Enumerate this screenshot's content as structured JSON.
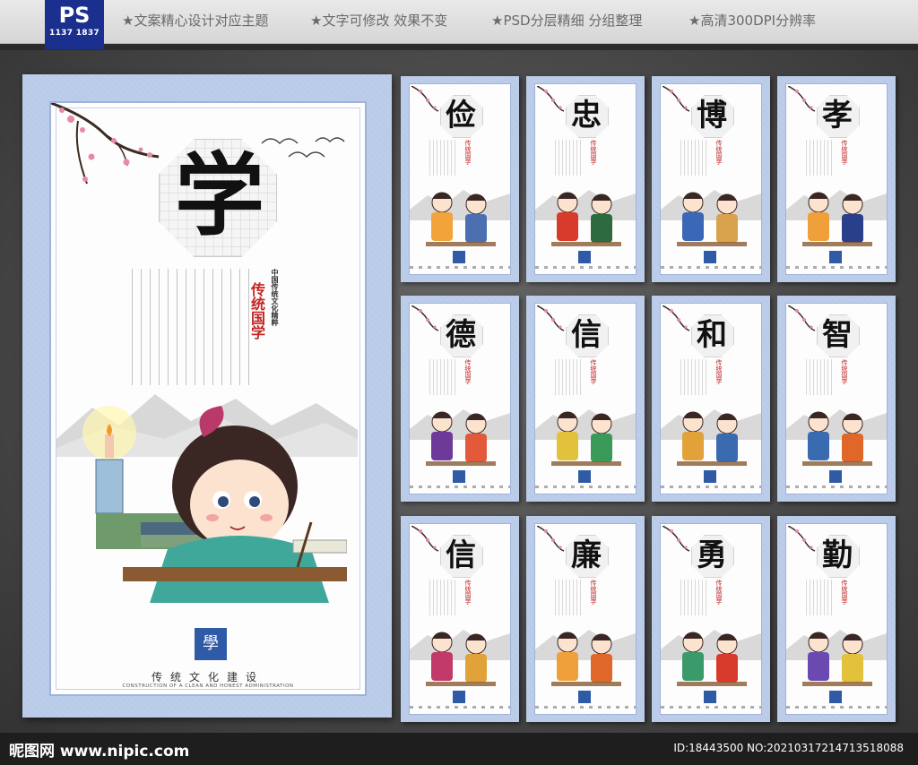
{
  "banner": {
    "badge_title": "PS",
    "badge_number": "1137 1837",
    "features": [
      "★文案精心设计对应主题",
      "★文字可修改 效果不变",
      "★PSD分层精细 分组整理",
      "★高清300DPI分辨率"
    ]
  },
  "main_poster": {
    "character": "学",
    "red_text": "传统国学",
    "culture_line": "中国传统文化精粹",
    "seal_char": "學",
    "footer_title": "传统文化建设",
    "footer_subtitle": "CONSTRUCTION OF A CLEAN AND HONEST ADMINISTRATION"
  },
  "small_posters": [
    {
      "character": "俭",
      "red_label": "传统国学"
    },
    {
      "character": "忠",
      "red_label": "传统国学"
    },
    {
      "character": "博",
      "red_label": "传统国学"
    },
    {
      "character": "孝",
      "red_label": "传统国学"
    },
    {
      "character": "德",
      "red_label": "传统国学"
    },
    {
      "character": "信",
      "red_label": "传统国学"
    },
    {
      "character": "和",
      "red_label": "传统国学"
    },
    {
      "character": "智",
      "red_label": "传统国学"
    },
    {
      "character": "信",
      "red_label": "传统国学"
    },
    {
      "character": "廉",
      "red_label": "传统国学"
    },
    {
      "character": "勇",
      "red_label": "传统国学"
    },
    {
      "character": "勤",
      "red_label": "传统国学"
    }
  ],
  "footer": {
    "site": "昵图网 www.nipic.com",
    "id_line": "ID:18443500 NO:20210317214713518088"
  },
  "colors": {
    "poster_frame": "#b9cbe9",
    "seal_blue": "#2f5aa6",
    "accent_red": "#c42323"
  }
}
